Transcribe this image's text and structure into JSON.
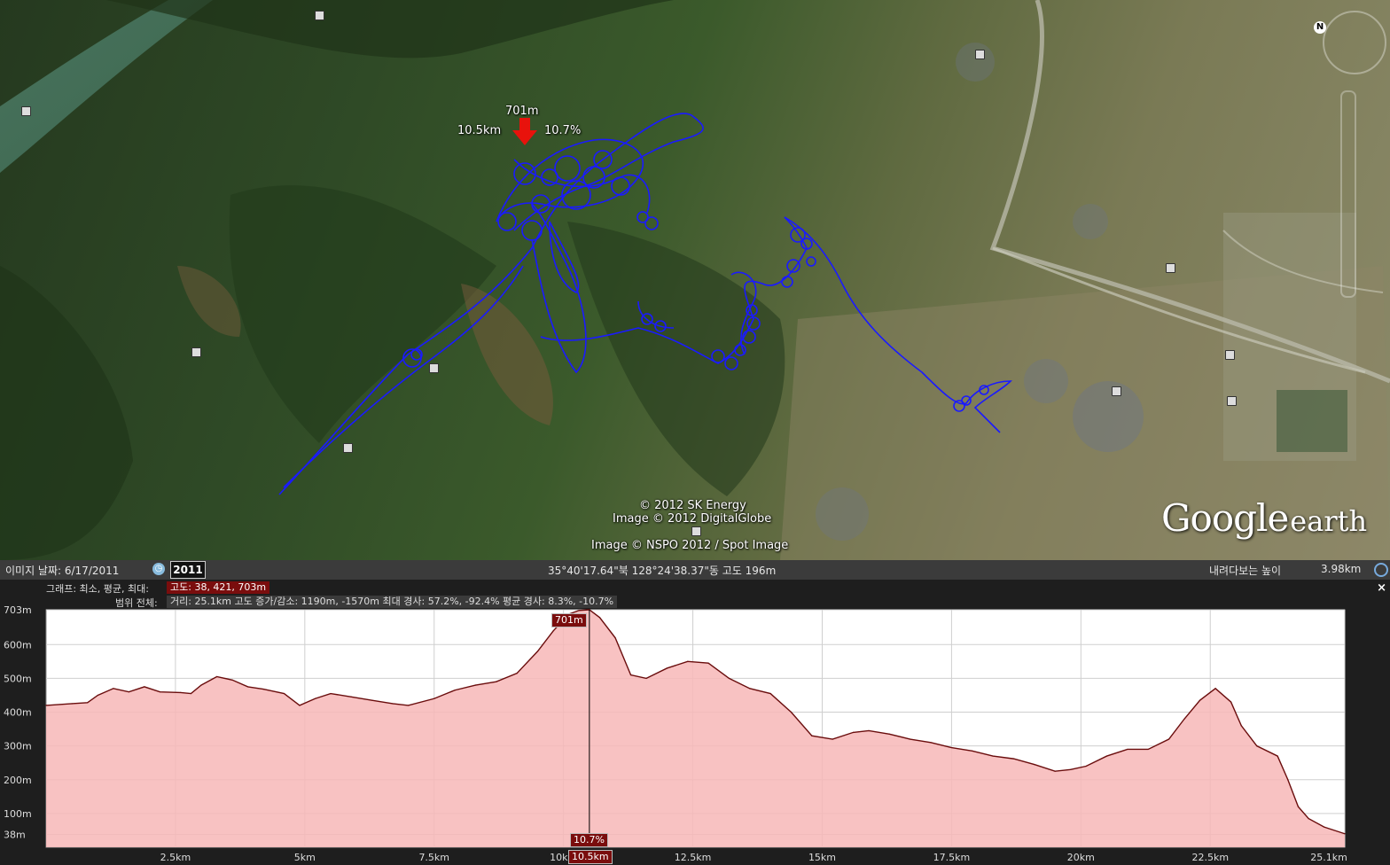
{
  "map": {
    "marker": {
      "elevation": "701m",
      "distance": "10.5km",
      "grade": "10.7%"
    },
    "attribution": [
      "© 2012 SK Energy",
      "Image © 2012 DigitalGlobe",
      "Image © NSPO 2012 / Spot Image"
    ],
    "logo": {
      "google": "Google",
      "earth": "earth"
    },
    "north_label": "N"
  },
  "statusbar": {
    "imagery_date": "이미지 날짜: 6/17/2011",
    "year": "2011",
    "coordinates": "35°40'17.64\"북 128°24'38.37\"동 고도  196m",
    "eye_alt_label": "내려다보는 높이",
    "eye_alt_value": "3.98km"
  },
  "profile": {
    "graph_label": "그래프: 최소, 평균, 최대:",
    "graph_values": "고도: 38, 421, 703m",
    "range_label": "범위 전체:",
    "range_values": "거리: 25.1km 고도 증가/감소: 1190m, -1570m 최대 경사: 57.2%, -92.4% 평균 경사: 8.3%, -10.7%",
    "close": "×",
    "cursor_elev": "701m",
    "cursor_grade": "10.7%",
    "cursor_dist": "10.5km"
  },
  "chart_data": {
    "type": "area",
    "xlabel": "",
    "ylabel": "",
    "xlim": [
      0,
      25.1
    ],
    "ylim": [
      0,
      703
    ],
    "ytick_labels": [
      "703m",
      "600m",
      "500m",
      "400m",
      "300m",
      "200m",
      "100m",
      "38m"
    ],
    "ytick_values": [
      703,
      600,
      500,
      400,
      300,
      200,
      100,
      38
    ],
    "xtick_labels": [
      "2.5km",
      "5km",
      "7.5km",
      "10km",
      "12.5km",
      "15km",
      "17.5km",
      "20km",
      "22.5km",
      "25.1km"
    ],
    "xtick_values": [
      2.5,
      5,
      7.5,
      10,
      12.5,
      15,
      17.5,
      20,
      22.5,
      25.1
    ],
    "cursor_x": 10.5,
    "colors": {
      "fill": "#f7b7b7",
      "line": "#6a0d0d",
      "cursor": "#000000"
    },
    "x": [
      0,
      0.5,
      0.8,
      1.0,
      1.3,
      1.6,
      1.9,
      2.2,
      2.6,
      2.8,
      3.0,
      3.3,
      3.6,
      3.9,
      4.2,
      4.6,
      4.9,
      5.2,
      5.5,
      5.9,
      6.3,
      6.7,
      7.0,
      7.5,
      7.9,
      8.3,
      8.7,
      9.1,
      9.5,
      9.8,
      10.1,
      10.3,
      10.5,
      10.7,
      11.0,
      11.3,
      11.6,
      12.0,
      12.4,
      12.8,
      13.2,
      13.6,
      14.0,
      14.4,
      14.8,
      15.2,
      15.6,
      15.9,
      16.3,
      16.7,
      17.1,
      17.5,
      17.9,
      18.3,
      18.7,
      19.1,
      19.5,
      19.8,
      20.1,
      20.5,
      20.9,
      21.3,
      21.7,
      22.0,
      22.3,
      22.6,
      22.9,
      23.1,
      23.4,
      23.8,
      24.0,
      24.2,
      24.4,
      24.7,
      25.1
    ],
    "y": [
      420,
      425,
      428,
      450,
      470,
      460,
      475,
      460,
      458,
      455,
      480,
      505,
      495,
      475,
      468,
      455,
      420,
      440,
      455,
      445,
      435,
      425,
      420,
      440,
      465,
      480,
      490,
      515,
      580,
      640,
      690,
      701,
      703,
      680,
      620,
      510,
      500,
      530,
      550,
      545,
      500,
      470,
      455,
      400,
      330,
      320,
      340,
      345,
      335,
      320,
      310,
      295,
      285,
      270,
      262,
      245,
      225,
      230,
      240,
      270,
      290,
      290,
      320,
      380,
      435,
      470,
      430,
      360,
      300,
      270,
      200,
      120,
      85,
      60,
      40
    ]
  }
}
